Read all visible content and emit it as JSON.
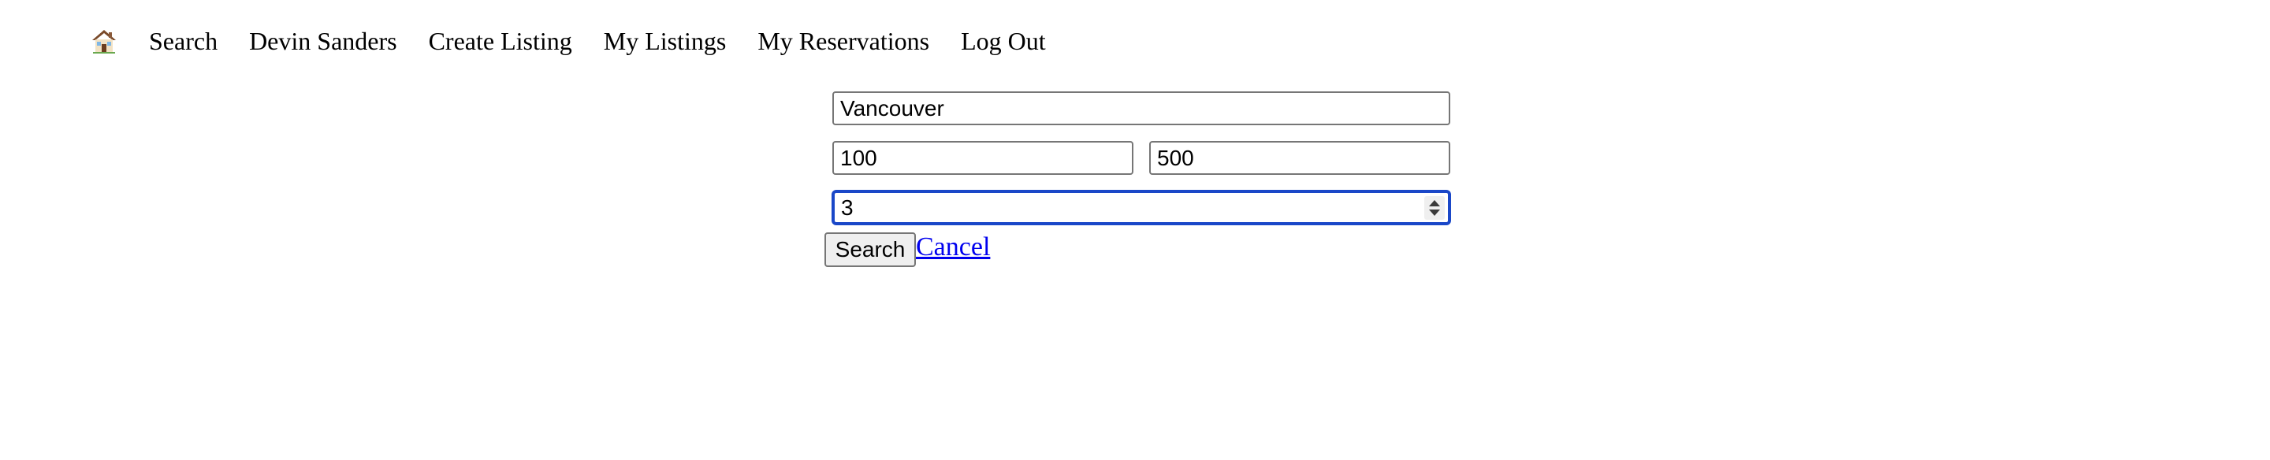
{
  "nav": {
    "home_icon": "house-icon",
    "items": [
      {
        "label": "Search"
      },
      {
        "label": "Devin Sanders"
      },
      {
        "label": "Create Listing"
      },
      {
        "label": "My Listings"
      },
      {
        "label": "My Reservations"
      },
      {
        "label": "Log Out"
      }
    ]
  },
  "search_form": {
    "location_value": "Vancouver",
    "min_price_value": "100",
    "max_price_value": "500",
    "guests_value": "3",
    "search_label": "Search",
    "cancel_label": "Cancel"
  },
  "colors": {
    "focus_ring": "#1a47c8",
    "link": "#0000ee",
    "input_border": "#767676",
    "button_bg": "#efefef"
  }
}
